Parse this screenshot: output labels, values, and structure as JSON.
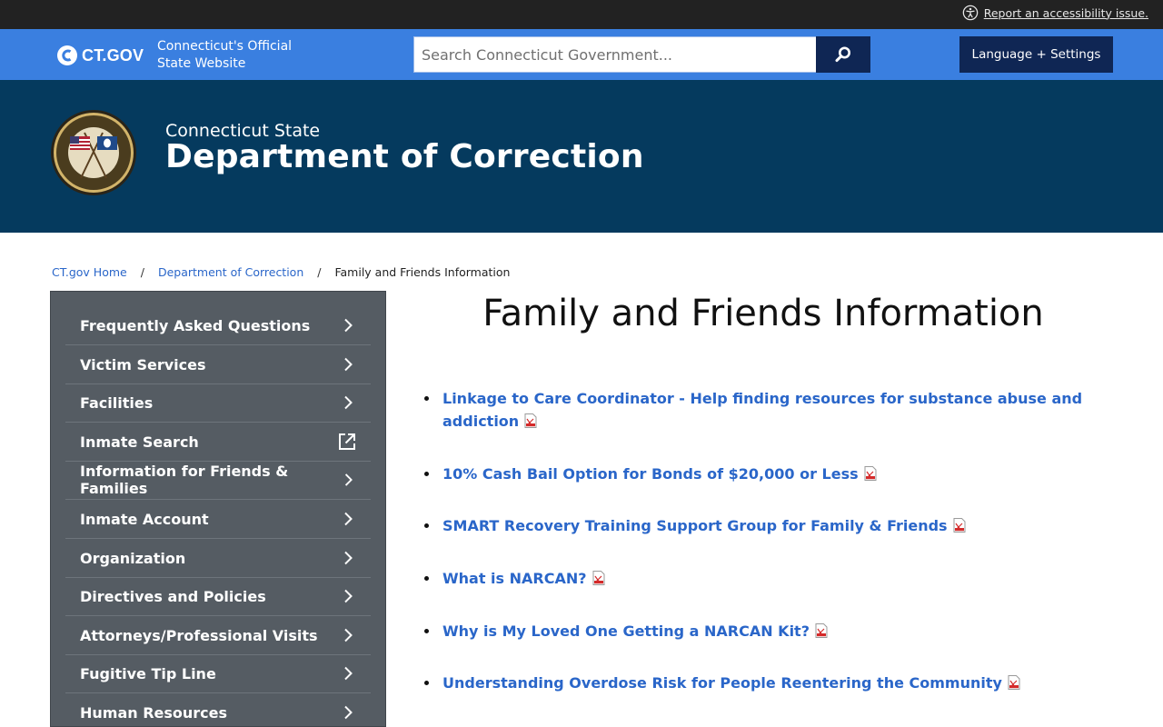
{
  "topbar": {
    "accessibility_link": "Report an accessibility issue."
  },
  "ctgov": {
    "logo_text": "CT.GOV",
    "tagline_line1": "Connecticut's Official",
    "tagline_line2": "State Website",
    "search_placeholder": "Search Connecticut Government...",
    "language_button": "Language + Settings"
  },
  "agency": {
    "subtitle": "Connecticut State",
    "title": "Department of Correction"
  },
  "breadcrumb": {
    "home": "CT.gov Home",
    "parent": "Department of Correction",
    "current": "Family and Friends Information",
    "separator": "/"
  },
  "sidebar": {
    "items": [
      {
        "label": "Frequently Asked Questions",
        "icon": "chevron-right-icon"
      },
      {
        "label": "Victim Services",
        "icon": "chevron-right-icon"
      },
      {
        "label": "Facilities",
        "icon": "chevron-right-icon"
      },
      {
        "label": "Inmate Search",
        "icon": "external-link-icon"
      },
      {
        "label": "Information for Friends & Families",
        "icon": "chevron-right-icon"
      },
      {
        "label": "Inmate Account",
        "icon": "chevron-right-icon"
      },
      {
        "label": "Organization",
        "icon": "chevron-right-icon"
      },
      {
        "label": "Directives and Policies",
        "icon": "chevron-right-icon"
      },
      {
        "label": "Attorneys/Professional Visits",
        "icon": "chevron-right-icon"
      },
      {
        "label": "Fugitive Tip Line",
        "icon": "chevron-right-icon"
      },
      {
        "label": "Human Resources",
        "icon": "chevron-right-icon"
      }
    ]
  },
  "main": {
    "title": "Family and Friends Information",
    "links": [
      {
        "label": "Linkage to Care Coordinator - Help finding resources for substance abuse and addiction"
      },
      {
        "label": "10% Cash Bail Option for Bonds of $20,000 or Less"
      },
      {
        "label": "SMART Recovery Training Support Group for Family & Friends"
      },
      {
        "label": "What is NARCAN?"
      },
      {
        "label": "Why is My Loved One Getting a NARCAN Kit?"
      },
      {
        "label": "Understanding Overdose Risk for People Reentering the Community"
      }
    ]
  },
  "colors": {
    "topbar": "#222222",
    "ctbar": "#3a7fe0",
    "navy_button": "#0f2654",
    "banner": "#053a5e",
    "sidebar": "#555c63",
    "link": "#2a66c9"
  }
}
